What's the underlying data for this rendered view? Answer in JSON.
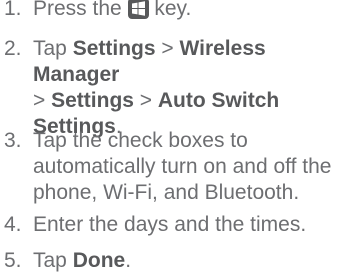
{
  "steps": [
    {
      "number": "1.",
      "parts": [
        "Press the ",
        " key."
      ],
      "icon": "windows-start-key-icon"
    },
    {
      "number": "2.",
      "line1": [
        "Tap ",
        "Settings",
        " > ",
        "Wireless Manager"
      ],
      "line2": [
        "> ",
        "Settings",
        " > ",
        "Auto Switch"
      ],
      "line3": [
        "Settings",
        "."
      ]
    },
    {
      "number": "3.",
      "lines": [
        "Tap the check boxes to",
        "automatically turn on and off the",
        "phone, Wi-Fi, and Bluetooth."
      ]
    },
    {
      "number": "4.",
      "text": "Enter the days and the times."
    },
    {
      "number": "5.",
      "parts": [
        "Tap ",
        "Done",
        "."
      ]
    }
  ],
  "colors": {
    "text": "#6d6e71",
    "bold": "#58595b",
    "icon_bg": "#58595b"
  }
}
